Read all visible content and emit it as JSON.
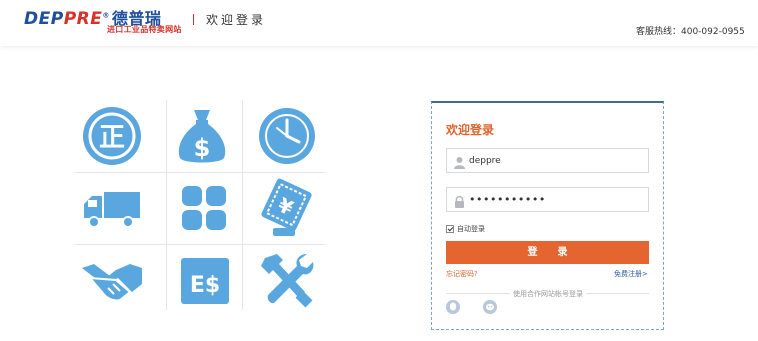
{
  "header": {
    "logo_text_blue": "DEP",
    "logo_text_red": "PRE",
    "logo_reg_mark": "®",
    "logo_cn": "德普瑞",
    "logo_tagline": "进口工业品特卖网站",
    "welcome_title": "欢迎登录",
    "hotline": "客服热线：400-092-0955"
  },
  "features": {
    "icons": [
      "authentic-badge-icon",
      "money-bag-icon",
      "clock-icon",
      "delivery-truck-icon",
      "category-grid-icon",
      "price-tag-icon",
      "handshake-icon",
      "invoice-icon",
      "tools-icon"
    ],
    "authentic_glyph": "正",
    "money_glyph": "$",
    "price_glyph": "¥",
    "invoice_glyph": "E$",
    "icon_color": "#5aa7e0"
  },
  "login": {
    "title": "欢迎登录",
    "username_value": "deppre",
    "password_value": "•••••••••••",
    "remember_label": "自动登录",
    "remember_checked": true,
    "submit_label": "登　　录",
    "forgot_label": "忘记密码?",
    "register_label": "免费注册>",
    "partner_label": "使用合作网站帐号登录",
    "accent_color": "#e4652f"
  }
}
